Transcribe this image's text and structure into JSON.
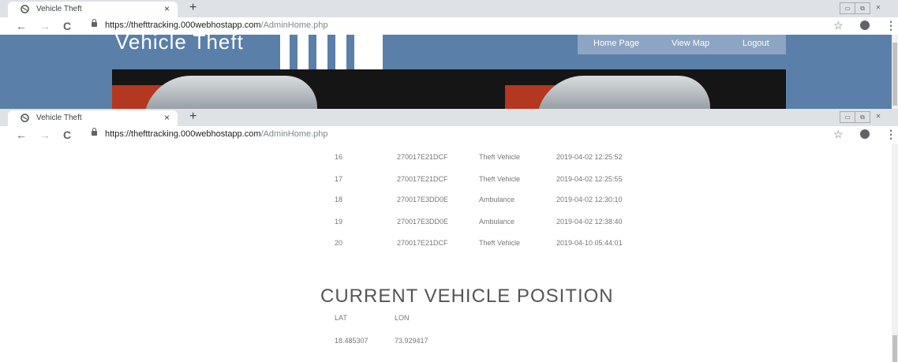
{
  "browser": {
    "tab_title": "Vehicle Theft",
    "tab_close": "×",
    "new_tab": "+",
    "url_host": "https://thefttracking.000webhostapp.com",
    "url_path": "/AdminHome.php",
    "back": "←",
    "forward": "→",
    "reload": "C",
    "star": "☆",
    "menu": "⋮",
    "window_controls": [
      "▭",
      "⧉",
      "✕"
    ]
  },
  "site": {
    "title": "Vehicle Theft",
    "nav": [
      "Home Page",
      "View Map",
      "Logout"
    ]
  },
  "table": {
    "rows": [
      {
        "id": "16",
        "tag": "270017E21DCF",
        "type": "Theft Vehicle",
        "time": "2019-04-02 12:25:52"
      },
      {
        "id": "17",
        "tag": "270017E21DCF",
        "type": "Theft Vehicle",
        "time": "2019-04-02 12:25:55"
      },
      {
        "id": "18",
        "tag": "270017E3DD0E",
        "type": "Ambulance",
        "time": "2019-04-02 12:30:10"
      },
      {
        "id": "19",
        "tag": "270017E3DD0E",
        "type": "Ambulance",
        "time": "2019-04-02 12:38:40"
      },
      {
        "id": "20",
        "tag": "270017E21DCF",
        "type": "Theft Vehicle",
        "time": "2019-04-10 05:44:01"
      }
    ]
  },
  "position": {
    "heading": "CURRENT VEHICLE POSITION",
    "lat_label": "LAT",
    "lon_label": "LON",
    "lat": "18.485307",
    "lon": "73.929417"
  },
  "colors": {
    "header_bg": "#5a7fa8",
    "nav_bg": "#8ca5c2"
  }
}
